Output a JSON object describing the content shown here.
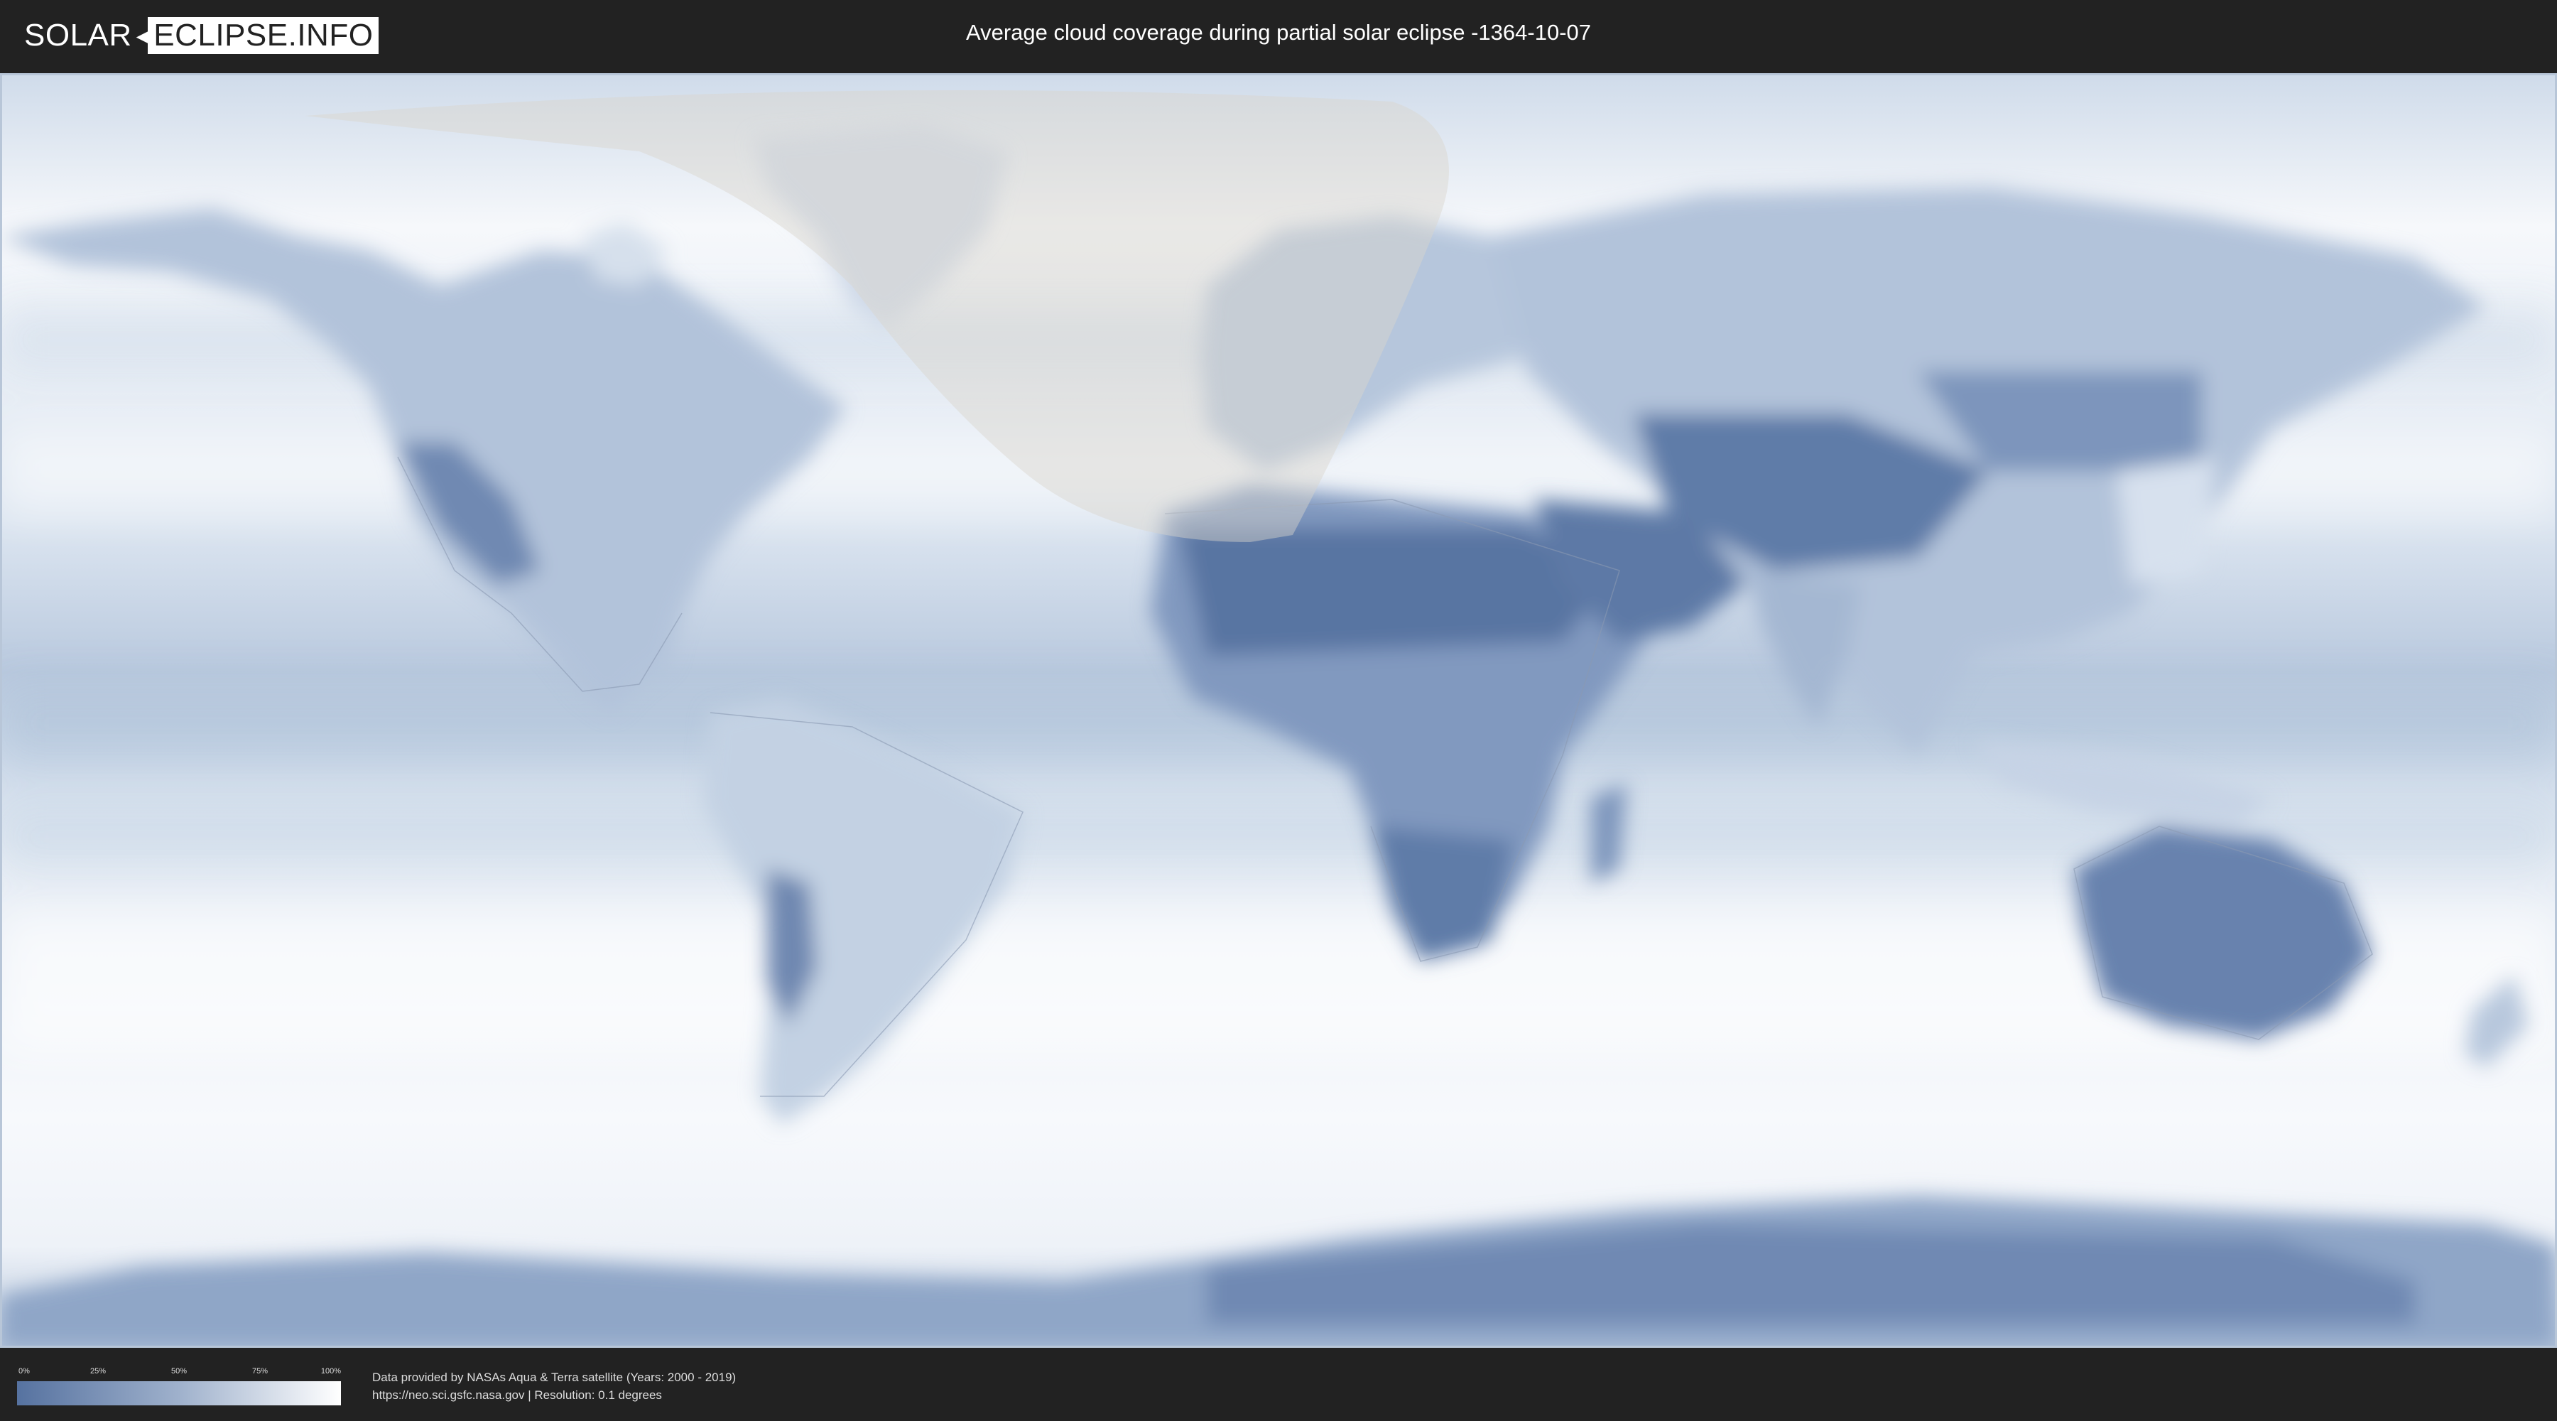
{
  "header": {
    "logo_left": "SOLAR",
    "logo_right": "ECLIPSE.INFO",
    "title": "Average cloud coverage during partial solar eclipse -1364-10-07"
  },
  "map": {
    "icon": "world-cloud-coverage-map",
    "ocean_color": "#e8eef6",
    "cloud_light_color": "#ffffff",
    "land_dry_color": "#5d78a6",
    "land_mid_color": "#9cb0cc",
    "eclipse_overlay_color": "#d9d4cc"
  },
  "legend": {
    "ticks": [
      "0%",
      "25%",
      "50%",
      "75%",
      "100%"
    ],
    "colors": [
      "#5672a0",
      "#ffffff"
    ]
  },
  "credits": {
    "line1": "Data provided by NASAs Aqua & Terra satellite (Years: 2000 - 2019)",
    "line2": "https://neo.sci.gsfc.nasa.gov | Resolution: 0.1 degrees"
  }
}
